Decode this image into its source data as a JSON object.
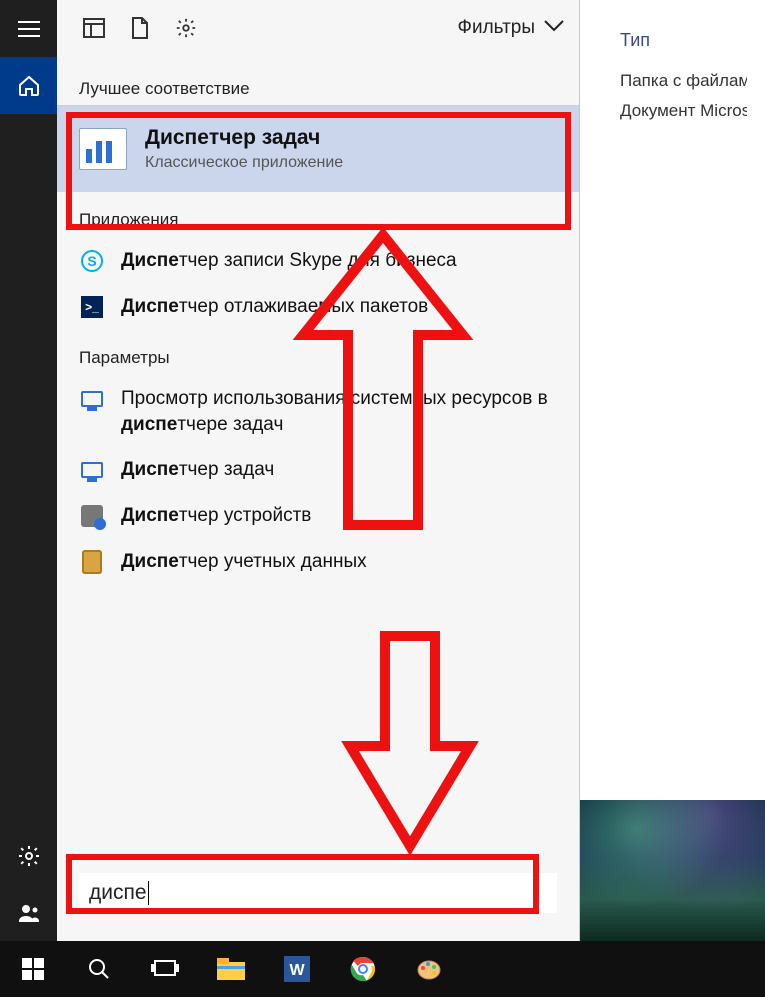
{
  "explorer": {
    "column_header": "Тип",
    "rows": [
      "Папка с файлам",
      "Документ Micros"
    ]
  },
  "sidebar": {
    "items": [
      "menu",
      "home",
      "settings",
      "people"
    ]
  },
  "panel_top": {
    "filters_label": "Фильтры"
  },
  "sections": {
    "best": "Лучшее соответствие",
    "apps": "Приложения",
    "settings": "Параметры"
  },
  "best_match": {
    "prefix": "Диспе",
    "rest": "тчер задач",
    "subtitle": "Классическое приложение"
  },
  "apps": [
    {
      "icon": "skype-icon",
      "prefix": "Диспе",
      "rest": "тчер записи Skype для бизнеса"
    },
    {
      "icon": "powershell-icon",
      "prefix": "Диспе",
      "rest": "тчер отлаживаемых пакетов"
    }
  ],
  "settings_results": [
    {
      "icon": "monitor-icon",
      "before": "Просмотр использования системных ресурсов в ",
      "prefix": "диспе",
      "rest": "тчере задач"
    },
    {
      "icon": "monitor-icon",
      "before": "",
      "prefix": "Диспе",
      "rest": "тчер задач"
    },
    {
      "icon": "device-icon",
      "before": "",
      "prefix": "Диспе",
      "rest": "тчер устройств"
    },
    {
      "icon": "credential-icon",
      "before": "",
      "prefix": "Диспе",
      "rest": "тчер учетных данных"
    }
  ],
  "search": {
    "value": "диспе"
  },
  "taskbar": {
    "items": [
      "start",
      "search",
      "task-view",
      "file-explorer",
      "word",
      "chrome",
      "paint"
    ]
  },
  "annotations": {
    "color": "#e11",
    "boxes": [
      "best-match",
      "search-input",
      "taskbar-search"
    ],
    "arrows": [
      "up",
      "down"
    ]
  }
}
